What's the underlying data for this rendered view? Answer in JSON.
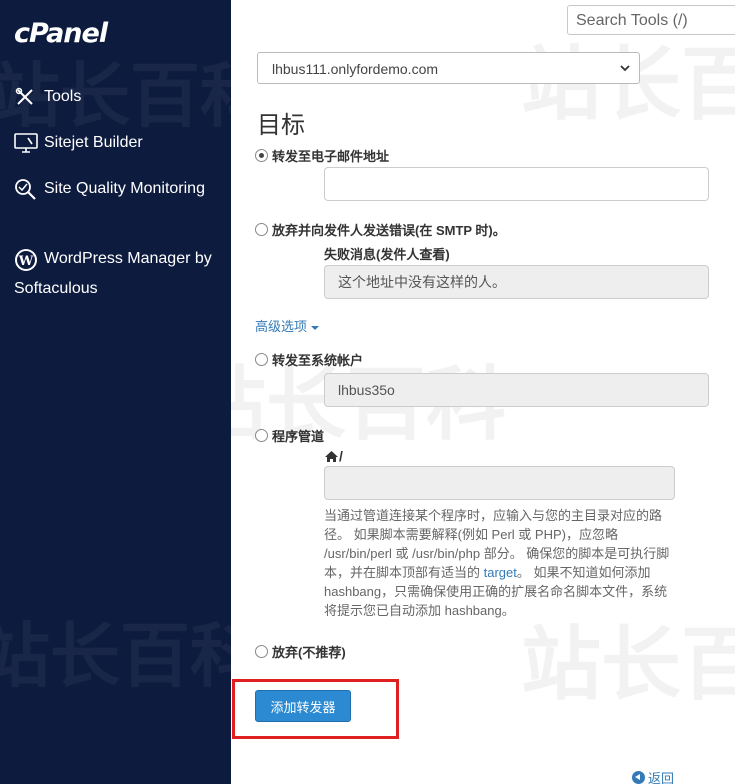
{
  "sidebar": {
    "logo": "cPanel",
    "items": [
      {
        "label": "Tools",
        "icon": "tools-icon"
      },
      {
        "label": "Sitejet Builder",
        "icon": "monitor-icon"
      },
      {
        "label": "Site Quality Monitoring",
        "icon": "magnifier-icon"
      },
      {
        "label": "WordPress Manager by Softaculous",
        "icon": "wordpress-icon"
      }
    ]
  },
  "watermark": "站长百科",
  "header": {
    "search_placeholder": "Search Tools (/)"
  },
  "form": {
    "domain_value": "lhbus111.onlyfordemo.com",
    "section_title": "目标",
    "options": {
      "forward_email": "转发至电子邮件地址",
      "discard_error": "放弃并向发件人发送错误(在 SMTP 时)。",
      "failure_message_label": "失败消息(发件人查看)",
      "failure_message_value": "这个地址中没有这样的人。",
      "advanced_label": "高级选项",
      "forward_system": "转发至系统帐户",
      "system_account_value": "lhbus35o",
      "pipe_program": "程序管道",
      "pipe_path_prefix": "/",
      "pipe_help_before_link": "当通过管道连接某个程序时，应输入与您的主目录对应的路径。 如果脚本需要解释(例如 Perl 或 PHP)，应忽略 /usr/bin/perl 或 /usr/bin/php 部分。 确保您的脚本是可执行脚本，并在脚本顶部有适当的 ",
      "pipe_help_link": "target",
      "pipe_help_after_link": "。 如果不知道如何添加 hashbang，只需确保使用正确的扩展名命名脚本文件，系统将提示您已自动添加 hashbang。",
      "discard_not_recommended": "放弃(不推荐)"
    },
    "submit_label": "添加转发器",
    "back_label": "返回"
  },
  "colors": {
    "sidebar_bg": "#0d1b3e",
    "accent": "#2b8ad1",
    "link": "#337ab7",
    "highlight_border": "#e02020"
  }
}
